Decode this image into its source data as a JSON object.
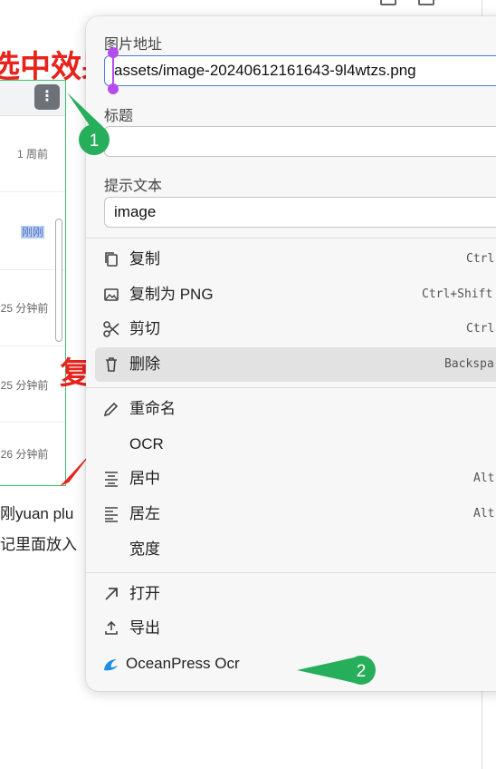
{
  "background": {
    "headline_1": "选中效果",
    "headline_2": "复",
    "times": [
      "1 周前",
      "刚刚",
      "25 分钟前",
      "25 分钟前",
      "26 分钟前"
    ],
    "text_line_1": "刚yuan plu",
    "text_line_2": "记里面放入"
  },
  "popup": {
    "image_address": {
      "label": "图片地址",
      "value": "assets/image-20240612161643-9l4wtzs.png"
    },
    "title_field": {
      "label": "标题",
      "value": ""
    },
    "alt_text": {
      "label": "提示文本",
      "value": "image"
    },
    "menu": {
      "copy": {
        "label": "复制",
        "shortcut": "Ctrl"
      },
      "copy_png": {
        "label": "复制为 PNG",
        "shortcut": "Ctrl+Shift"
      },
      "cut": {
        "label": "剪切",
        "shortcut": "Ctrl"
      },
      "delete": {
        "label": "删除",
        "shortcut": "Backspa"
      },
      "rename": {
        "label": "重命名"
      },
      "ocr": {
        "label": "OCR"
      },
      "center": {
        "label": "居中",
        "shortcut": "Alt"
      },
      "left": {
        "label": "居左",
        "shortcut": "Alt"
      },
      "width": {
        "label": "宽度"
      },
      "open": {
        "label": "打开"
      },
      "export": {
        "label": "导出"
      },
      "oceanpress": {
        "label": "OceanPress Ocr"
      }
    }
  },
  "callouts": {
    "first": "1",
    "second": "2"
  },
  "colors": {
    "accent_green": "#27ae5a",
    "handle_purple": "#b44cf0",
    "annotation_red": "#e8231d",
    "focus_blue": "#4f7be0"
  }
}
